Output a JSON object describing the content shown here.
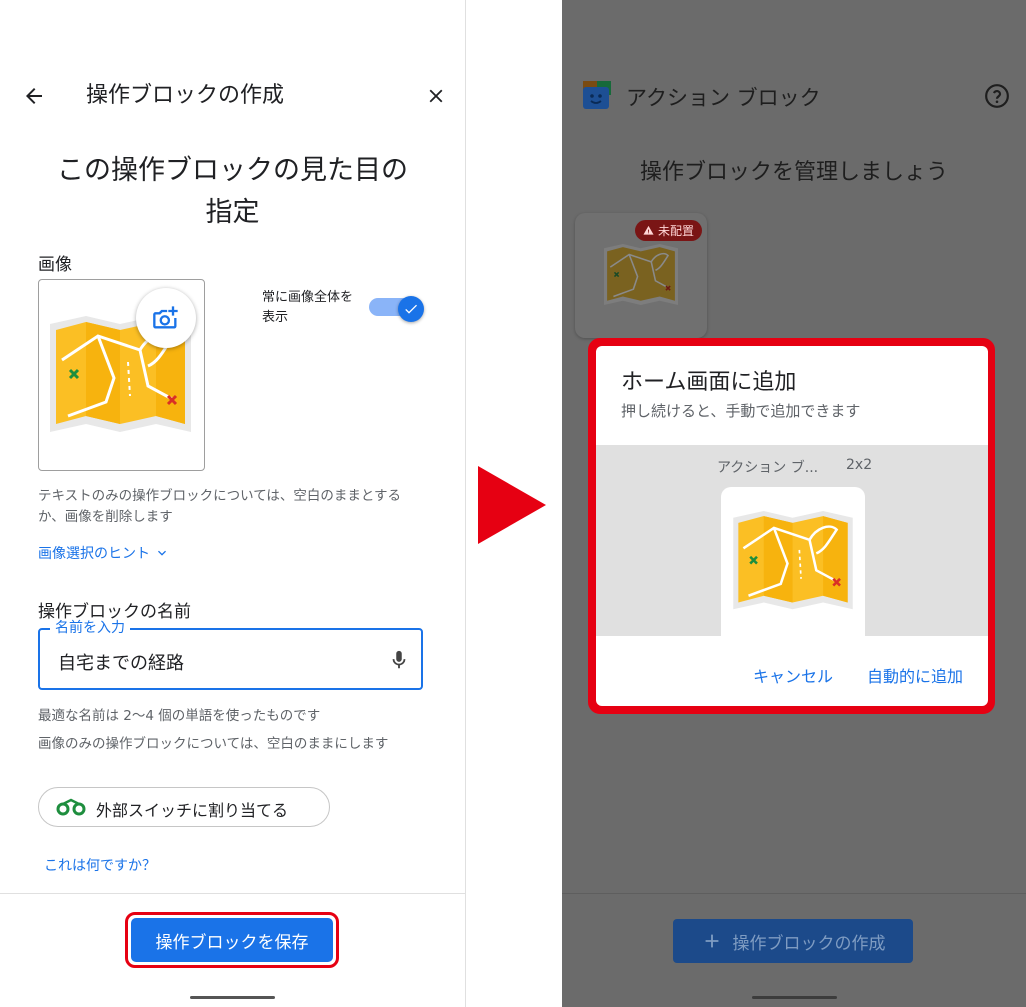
{
  "left": {
    "title": "操作ブロックの作成",
    "heading_line1": "この操作ブロックの見た目の",
    "heading_line2": "指定",
    "image_label": "画像",
    "toggle_label_line1": "常に画像全体を",
    "toggle_label_line2": "表示",
    "toggle_on": true,
    "image_hint_line1": "テキストのみの操作ブロックについては、空白のままとする",
    "image_hint_line2": "か、画像を削除します",
    "image_tips_link": "画像選択のヒント",
    "name_section_label": "操作ブロックの名前",
    "name_field_label": "名前を入力",
    "name_field_value": "自宅までの経路",
    "name_hint1": "最適な名前は 2〜4 個の単語を使ったものです",
    "name_hint2": "画像のみの操作ブロックについては、空白のままにします",
    "switch_chip_label": "外部スイッチに割り当てる",
    "what_is_this_link": "これは何ですか？",
    "save_button": "操作ブロックを保存"
  },
  "right": {
    "app_title": "アクション ブロック",
    "heading": "操作ブロックを管理しましょう",
    "tile_badge": "未配置",
    "dialog": {
      "title": "ホーム画面に追加",
      "subtitle": "押し続けると、手動で追加できます",
      "widget_name": "アクション ブ...",
      "widget_size": "2x2",
      "cancel_button": "キャンセル",
      "auto_add_button": "自動的に追加"
    },
    "create_button": "操作ブロックの作成"
  },
  "colors": {
    "accent_blue": "#1a73e8",
    "highlight_red": "#e60012",
    "map_yellow": "#fbbf24"
  },
  "icons": [
    "back-arrow-icon",
    "close-icon",
    "camera-add-icon",
    "check-icon",
    "chevron-down-icon",
    "microphone-icon",
    "switch-icon",
    "arrow-right-icon",
    "app-logo-icon",
    "help-icon",
    "warning-icon",
    "plus-icon",
    "map-icon"
  ]
}
